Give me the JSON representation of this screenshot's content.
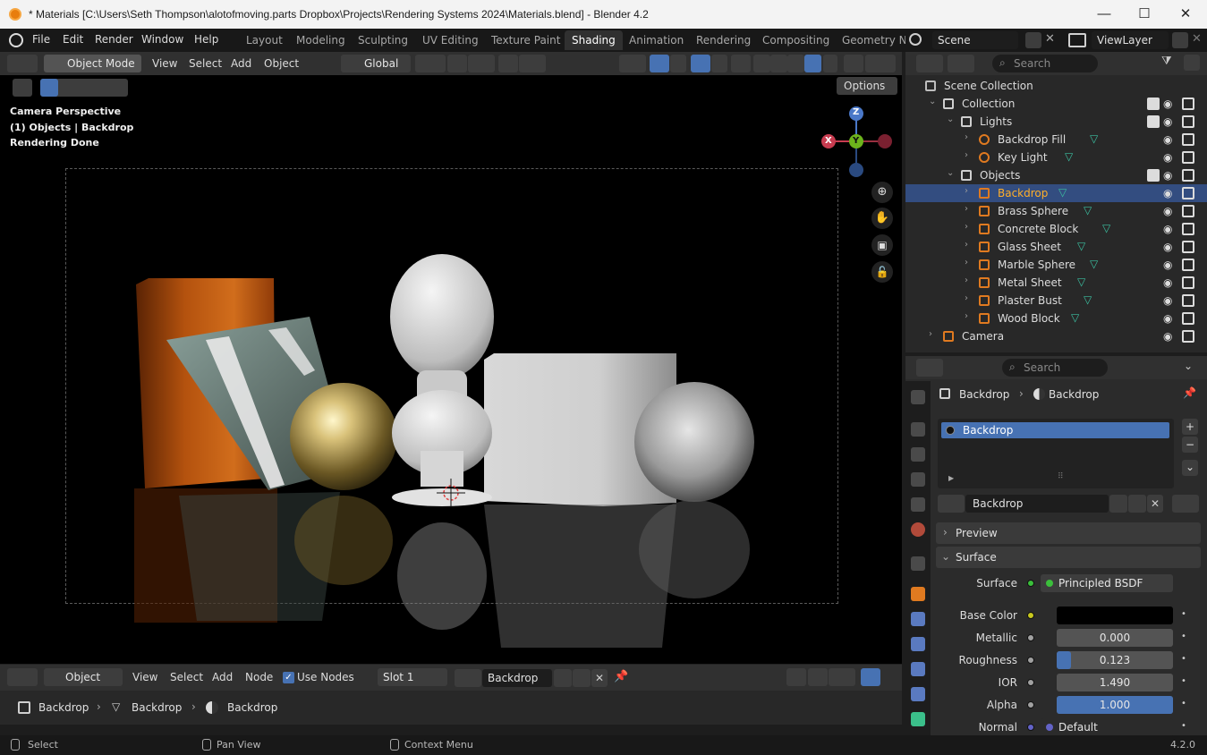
{
  "window": {
    "title": "* Materials [C:\\Users\\Seth Thompson\\alotofmoving.parts Dropbox\\Projects\\Rendering Systems 2024\\Materials.blend] - Blender 4.2",
    "min": "—",
    "max": "☐",
    "close": "✕"
  },
  "menu": {
    "items": [
      "File",
      "Edit",
      "Render",
      "Window",
      "Help"
    ],
    "workspaces": [
      "Layout",
      "Modeling",
      "Sculpting",
      "UV Editing",
      "Texture Paint",
      "Shading",
      "Animation",
      "Rendering",
      "Compositing",
      "Geometry N"
    ],
    "active_workspace": "Shading",
    "scene": "Scene",
    "view_layer": "ViewLayer"
  },
  "viewport": {
    "mode": "Object Mode",
    "menus": [
      "View",
      "Select",
      "Add",
      "Object"
    ],
    "orientation": "Global",
    "options": "Options",
    "overlay_lines": [
      "Camera Perspective",
      "(1) Objects | Backdrop",
      "Rendering Done"
    ],
    "gizmo": {
      "x": "X",
      "y": "Y",
      "z": "Z"
    }
  },
  "outliner": {
    "search_placeholder": "Search",
    "rows": [
      {
        "label": "Scene Collection",
        "indent": 0,
        "kind": "scene"
      },
      {
        "label": "Collection",
        "indent": 1,
        "kind": "collection"
      },
      {
        "label": "Lights",
        "indent": 2,
        "kind": "collection"
      },
      {
        "label": "Backdrop Fill",
        "indent": 3,
        "kind": "light"
      },
      {
        "label": "Key Light",
        "indent": 3,
        "kind": "light"
      },
      {
        "label": "Objects",
        "indent": 2,
        "kind": "collection"
      },
      {
        "label": "Backdrop",
        "indent": 3,
        "kind": "mesh",
        "selected": true
      },
      {
        "label": "Brass Sphere",
        "indent": 3,
        "kind": "mesh"
      },
      {
        "label": "Concrete  Block",
        "indent": 3,
        "kind": "mesh"
      },
      {
        "label": "Glass Sheet",
        "indent": 3,
        "kind": "mesh"
      },
      {
        "label": "Marble Sphere",
        "indent": 3,
        "kind": "mesh"
      },
      {
        "label": "Metal Sheet",
        "indent": 3,
        "kind": "mesh"
      },
      {
        "label": "Plaster Bust",
        "indent": 3,
        "kind": "mesh"
      },
      {
        "label": "Wood Block",
        "indent": 3,
        "kind": "mesh"
      },
      {
        "label": "Camera",
        "indent": 1,
        "kind": "camera"
      }
    ]
  },
  "properties": {
    "search_placeholder": "Search",
    "breadcrumb": [
      "Backdrop",
      "Backdrop"
    ],
    "material_slot": "Backdrop",
    "material_name": "Backdrop",
    "sections": {
      "preview": "Preview",
      "surface": "Surface"
    },
    "fields": [
      {
        "label": "Surface",
        "value": "Principled BSDF",
        "dot": "#3bbf3b"
      },
      {
        "label": "Base Color",
        "value": "",
        "dot": "#c8c81e"
      },
      {
        "label": "Metallic",
        "value": "0.000",
        "fill": 0.0
      },
      {
        "label": "Roughness",
        "value": "0.123",
        "fill": 0.123
      },
      {
        "label": "IOR",
        "value": "1.490",
        "fill": 0.0
      },
      {
        "label": "Alpha",
        "value": "1.000",
        "fill": 1.0
      },
      {
        "label": "Normal",
        "value": "Default",
        "dot": "#6363c7"
      }
    ]
  },
  "node_editor": {
    "type": "Object",
    "menus": [
      "View",
      "Select",
      "Add",
      "Node"
    ],
    "use_nodes": "Use Nodes",
    "slot": "Slot 1",
    "material": "Backdrop",
    "breadcrumb": [
      "Backdrop",
      "Backdrop",
      "Backdrop"
    ]
  },
  "status": {
    "select": "Select",
    "pan": "Pan View",
    "context": "Context Menu",
    "version": "4.2.0"
  }
}
